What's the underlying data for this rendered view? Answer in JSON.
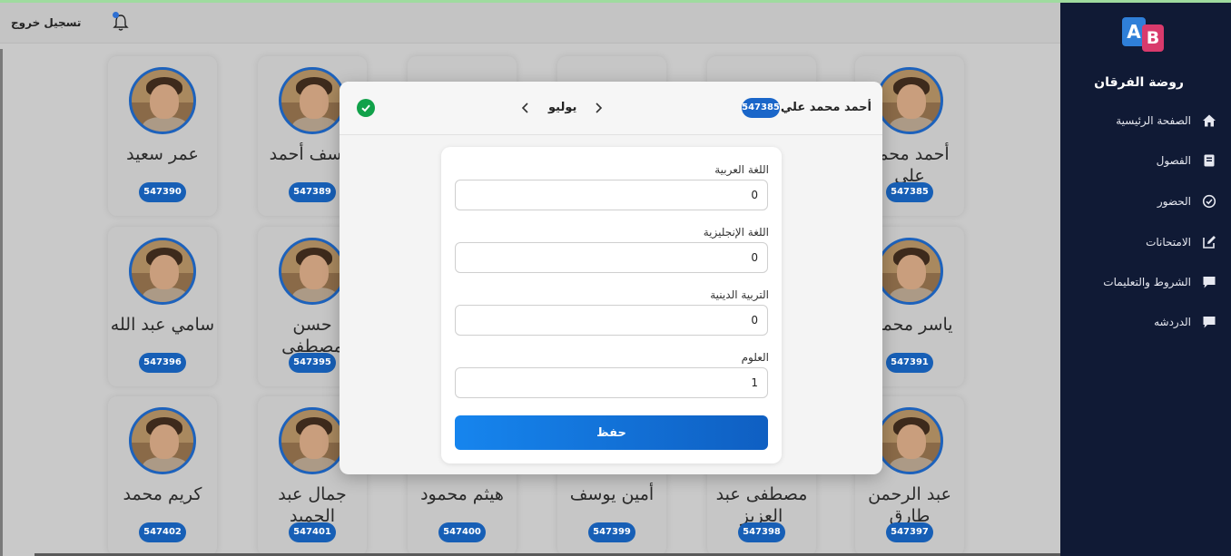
{
  "header": {
    "logout_label": "تسجيل خروج",
    "notification_icon": "bell-icon",
    "notification_dot_color": "#2d6fd2"
  },
  "sidebar": {
    "logo_letters": [
      "A",
      "B"
    ],
    "school_name": "روضة الفرقان",
    "background_color": "#101a35",
    "items": [
      {
        "label": "الصفحة الرئيسية",
        "icon": "home-icon"
      },
      {
        "label": "الفصول",
        "icon": "book-icon"
      },
      {
        "label": "الحضور",
        "icon": "check-circle-icon"
      },
      {
        "label": "الامتحانات",
        "icon": "edit-icon"
      },
      {
        "label": "الشروط والتعليمات",
        "icon": "comment-icon"
      },
      {
        "label": "الدردشه",
        "icon": "chat-icon"
      }
    ]
  },
  "students": [
    {
      "name": "أحمد محمد علي",
      "id": "547385"
    },
    {
      "name": "عمر سعيد",
      "id": "547390"
    },
    {
      "name": "يوسف أحمد",
      "id": "547389"
    },
    {
      "name": "ياسر محمود",
      "id": "547391"
    },
    {
      "name": "حسن مصطفى",
      "id": "547395"
    },
    {
      "name": "سامي عبد الله",
      "id": "547396"
    },
    {
      "name": "عبد الرحمن طارق",
      "id": "547397"
    },
    {
      "name": "مصطفى عبد العزيز",
      "id": "547398"
    },
    {
      "name": "أمين يوسف",
      "id": "547399"
    },
    {
      "name": "هيثم محمود",
      "id": "547400"
    },
    {
      "name": "جمال عبد الحميد",
      "id": "547401"
    },
    {
      "name": "كريم محمد",
      "id": "547402"
    }
  ],
  "modal": {
    "student_name": "أحمد محمد علي",
    "student_id": "547385",
    "month": "يوليو",
    "prev_icon": "chevron-left-icon",
    "next_icon": "chevron-right-icon",
    "status_icon": "check-circle-icon",
    "status_color": "#11a14a",
    "fields": [
      {
        "label": "اللغة العربية",
        "value": "0"
      },
      {
        "label": "اللغة الإنجليزية",
        "value": "0"
      },
      {
        "label": "التربية الدينية",
        "value": "0"
      },
      {
        "label": "العلوم",
        "value": "1"
      }
    ],
    "save_label": "حفظ",
    "accent_color": "#1685ee"
  }
}
